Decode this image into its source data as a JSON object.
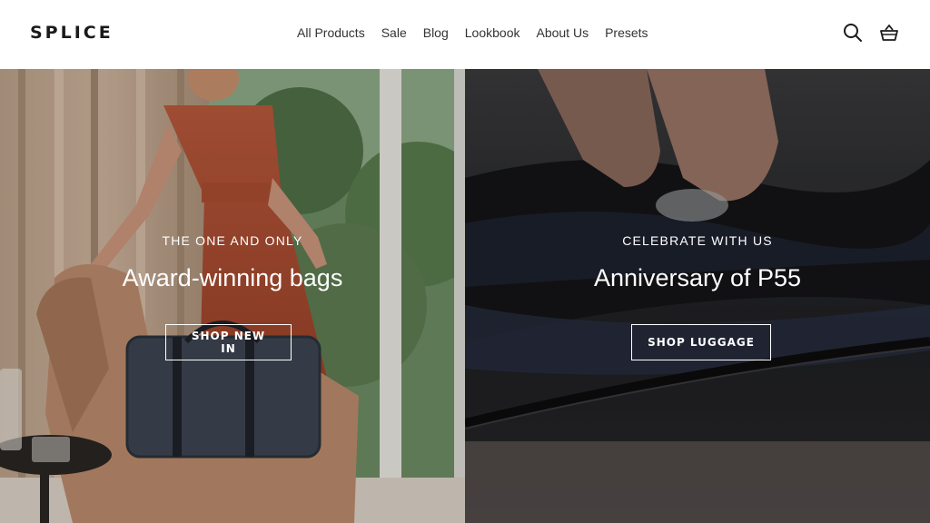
{
  "header": {
    "logo": "SPLICE",
    "nav": [
      "All Products",
      "Sale",
      "Blog",
      "Lookbook",
      "About Us",
      "Presets"
    ]
  },
  "hero": {
    "left": {
      "eyebrow": "THE ONE AND ONLY",
      "headline": "Award-winning bags",
      "cta": "SHOP NEW IN"
    },
    "right": {
      "eyebrow": "CELEBRATE WITH US",
      "headline": "Anniversary of P55",
      "cta": "SHOP LUGGAGE"
    }
  },
  "icons": [
    "search-icon",
    "basket-icon"
  ],
  "colors": {
    "header_bg": "#ffffff",
    "text_dark": "#1a1a1a",
    "overlay_text": "#ffffff"
  }
}
